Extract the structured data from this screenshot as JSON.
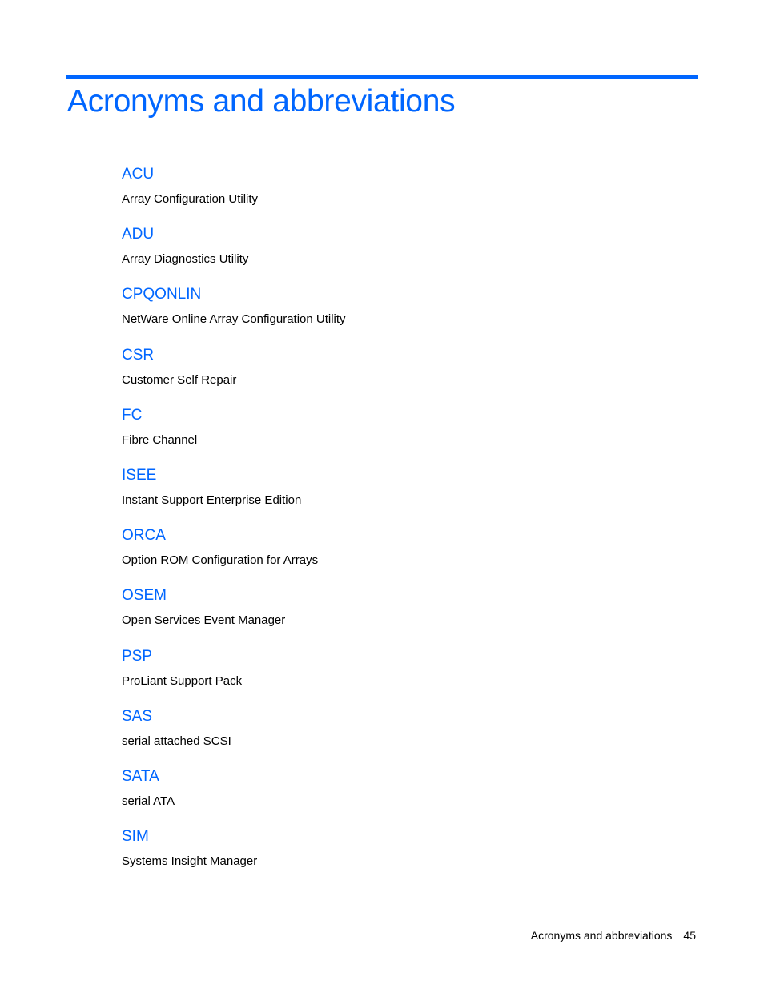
{
  "page": {
    "title": "Acronyms and abbreviations",
    "accent_color": "#0066ff"
  },
  "entries": [
    {
      "term": "ACU",
      "definition": "Array Configuration Utility"
    },
    {
      "term": "ADU",
      "definition": "Array Diagnostics Utility"
    },
    {
      "term": "CPQONLIN",
      "definition": "NetWare Online Array Configuration Utility"
    },
    {
      "term": "CSR",
      "definition": "Customer Self Repair"
    },
    {
      "term": "FC",
      "definition": "Fibre Channel"
    },
    {
      "term": "ISEE",
      "definition": "Instant Support Enterprise Edition"
    },
    {
      "term": "ORCA",
      "definition": "Option ROM Configuration for Arrays"
    },
    {
      "term": "OSEM",
      "definition": "Open Services Event Manager"
    },
    {
      "term": "PSP",
      "definition": "ProLiant Support Pack"
    },
    {
      "term": "SAS",
      "definition": "serial attached SCSI"
    },
    {
      "term": "SATA",
      "definition": "serial ATA"
    },
    {
      "term": "SIM",
      "definition": "Systems Insight Manager"
    }
  ],
  "footer": {
    "section_title": "Acronyms and abbreviations",
    "page_number": "45"
  }
}
